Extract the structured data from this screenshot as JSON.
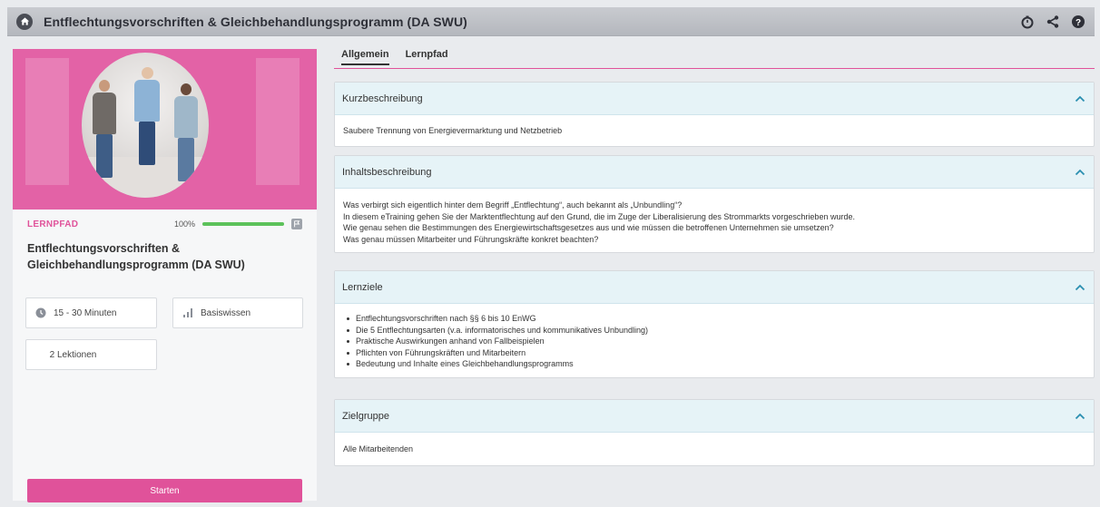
{
  "window": {
    "title": "Entflechtungsvorschriften & Gleichbehandlungsprogramm (DA SWU)",
    "icons": [
      "home-icon",
      "timer-icon",
      "share-icon",
      "help-icon"
    ]
  },
  "course": {
    "type_label": "LERNPFAD",
    "progress_text": "100%",
    "progress_fraction": 1.0,
    "title": "Entflechtungsvorschriften & Gleichbehandlungsprogramm (DA SWU)",
    "duration": "15 - 30 Minuten",
    "level": "Basiswissen",
    "lessons": "2 Lektionen",
    "start_label": "Starten"
  },
  "tabs": [
    {
      "label": "Allgemein",
      "active": true
    },
    {
      "label": "Lernpfad",
      "active": false
    }
  ],
  "sections": {
    "kurz": {
      "title": "Kurzbeschreibung",
      "text": "Saubere Trennung von Energievermarktung und Netzbetrieb"
    },
    "inhalt": {
      "title": "Inhaltsbeschreibung",
      "lines": [
        "Was verbirgt sich eigentlich hinter dem Begriff „Entflechtung“, auch bekannt als „Unbundling“?",
        "In diesem eTraining gehen Sie der Marktentflechtung auf den Grund, die im Zuge der Liberalisierung des Strommarkts vorgeschrieben wurde.",
        "Wie genau sehen die Bestimmungen des Energiewirtschaftsgesetzes aus und wie müssen die betroffenen Unternehmen sie umsetzen?",
        "Was genau müssen Mitarbeiter und Führungskräfte konkret beachten?"
      ]
    },
    "lernziele": {
      "title": "Lernziele",
      "items": [
        "Entflechtungsvorschriften nach §§ 6 bis 10 EnWG",
        "Die 5 Entflechtungsarten (v.a. informatorisches und kommunikatives Unbundling)",
        "Praktische Auswirkungen anhand von Fallbeispielen",
        "Pflichten von Führungskräften und Mitarbeitern",
        "Bedeutung und Inhalte eines Gleichbehandlungsprogramms"
      ]
    },
    "zielgruppe": {
      "title": "Zielgruppe",
      "text": "Alle Mitarbeitenden"
    }
  },
  "colors": {
    "accent": "#e0529a",
    "progress": "#5cc25a",
    "section_header": "#e6f3f7"
  }
}
